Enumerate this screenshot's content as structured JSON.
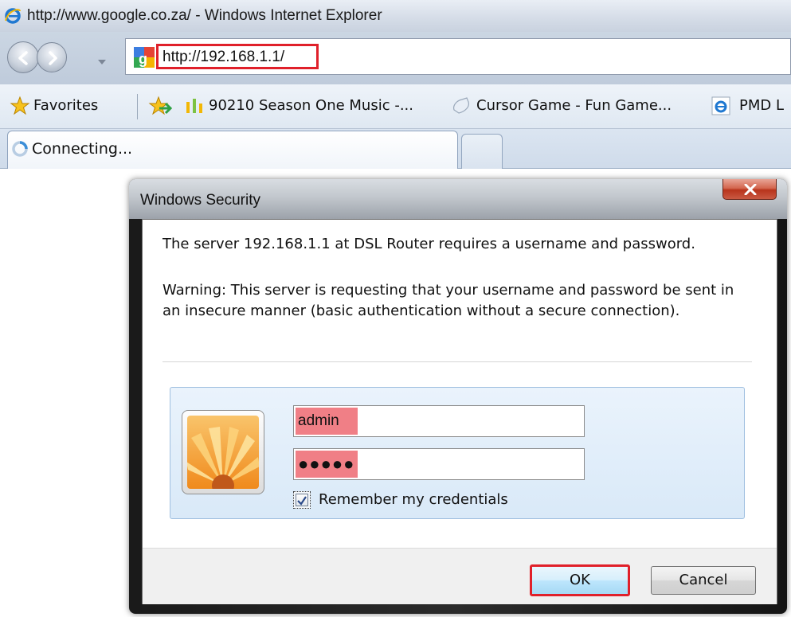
{
  "window": {
    "title": "http://www.google.co.za/ - Windows Internet Explorer"
  },
  "address_bar": {
    "url": "http://192.168.1.1/"
  },
  "favorites_bar": {
    "favorites_label": "Favorites",
    "items": [
      {
        "label": "90210 Season One Music -..."
      },
      {
        "label": "Cursor Game - Fun Game..."
      },
      {
        "label": "PMD L"
      }
    ]
  },
  "tabs": {
    "active_label": "Connecting..."
  },
  "dialog": {
    "title": "Windows Security",
    "message": "The server 192.168.1.1 at DSL Router requires a username and password.",
    "warning": "Warning: This server is requesting that your username and password be sent in an insecure manner (basic authentication without a secure connection).",
    "username_value": "admin",
    "password_value": "●●●●●",
    "remember_label": "Remember my credentials",
    "remember_checked": true,
    "ok_label": "OK",
    "cancel_label": "Cancel"
  },
  "colors": {
    "highlight_red": "#e0202a",
    "field_highlight": "#f07f86",
    "panel_blue": "#d9e9f8"
  },
  "icons": {
    "app": "ie-icon",
    "back": "back-arrow-icon",
    "forward": "forward-arrow-icon",
    "site": "google-favicon-icon",
    "favorites": "star-icon",
    "add_favorite": "add-to-favorites-icon",
    "tab_loading": "loading-spinner-icon",
    "user_picture": "flower-user-icon",
    "close": "close-icon"
  }
}
